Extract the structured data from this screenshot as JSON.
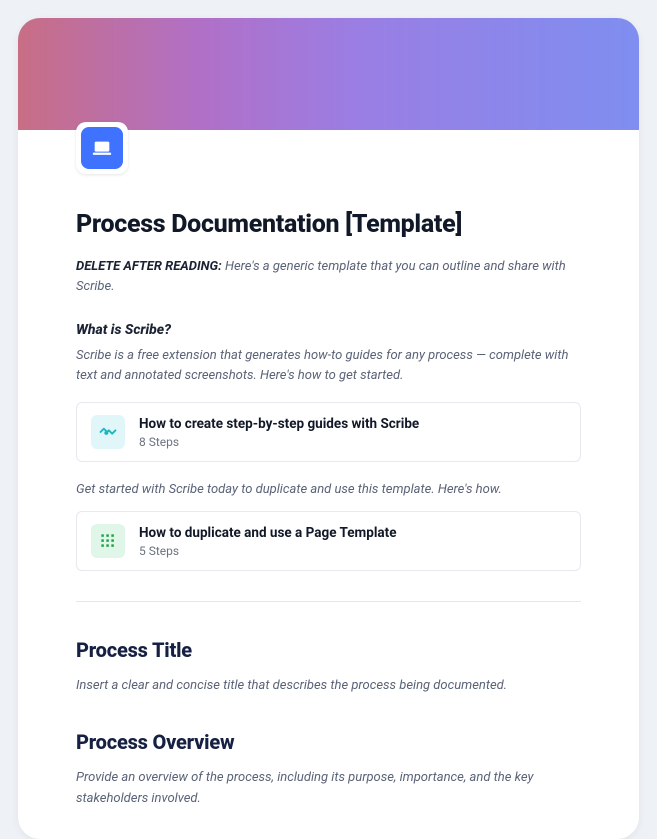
{
  "header": {
    "icon": "laptop-icon"
  },
  "title": "Process Documentation [Template]",
  "deleteNote": {
    "label": "DELETE AFTER READING:",
    "text": " Here's a generic template that you can outline and share with Scribe."
  },
  "whatIs": {
    "heading": "What is Scribe?",
    "body": "Scribe is a free extension that generates how-to guides for any process — complete with text and annotated screenshots. Here's how to get started."
  },
  "guides": [
    {
      "title": "How to create step-by-step guides with Scribe",
      "steps": "8 Steps",
      "icon": "handshake-icon",
      "iconBg": "#e0f6f8",
      "iconFg": "#1fb6c1"
    },
    {
      "title": "How to duplicate and use a Page Template",
      "steps": "5 Steps",
      "icon": "grid-icon",
      "iconBg": "#e0f6e9",
      "iconFg": "#1fa34a"
    }
  ],
  "between": "Get started with Scribe today to duplicate and use this template. Here's how.",
  "sections": [
    {
      "heading": "Process Title",
      "desc": "Insert a clear and concise title that describes the process being documented."
    },
    {
      "heading": "Process Overview",
      "desc": "Provide an overview of the process, including its purpose, importance, and the key stakeholders involved."
    }
  ]
}
